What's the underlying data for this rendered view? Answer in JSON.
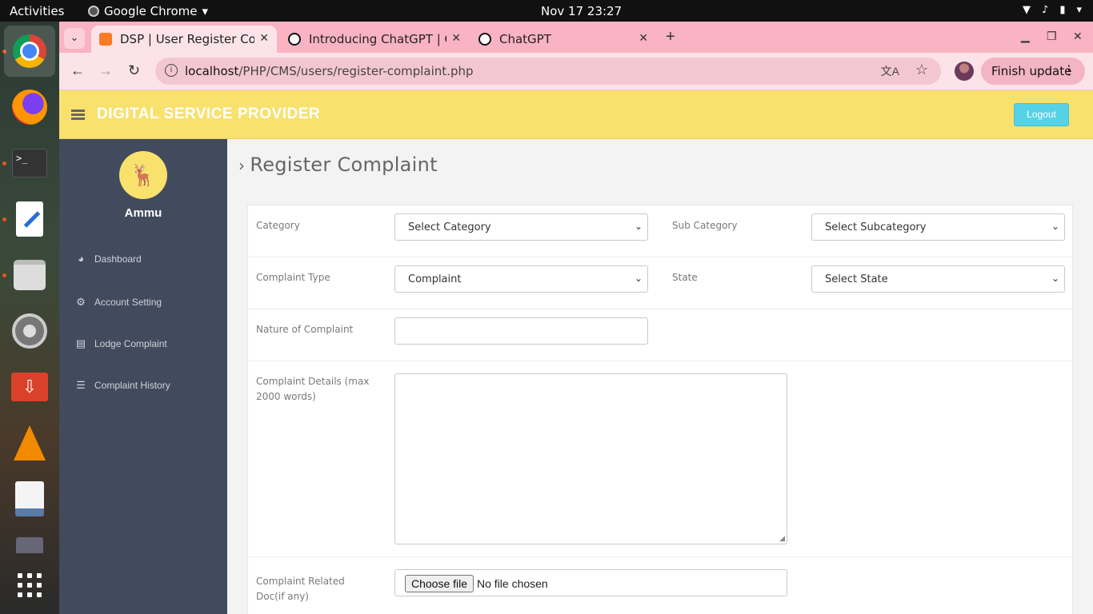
{
  "os": {
    "activities": "Activities",
    "app_name": "Google Chrome",
    "clock": "Nov 17  23:27"
  },
  "dock": {
    "terminal_glyph": ">_",
    "download_glyph": "⇩",
    "icons": [
      "chrome-icon",
      "firefox-icon",
      "terminal-icon",
      "text-editor-icon",
      "files-icon",
      "settings-icon",
      "downloader-icon",
      "vlc-icon",
      "reader-icon",
      "disk-icon",
      "app-grid-icon"
    ]
  },
  "browser": {
    "tabs": [
      {
        "title": "DSP | User Register Com",
        "active": true
      },
      {
        "title": "Introducing ChatGPT | O",
        "active": false
      },
      {
        "title": "ChatGPT",
        "active": false
      }
    ],
    "url_host": "localhost",
    "url_path": "/PHP/CMS/users/register-complaint.php",
    "finish_update": "Finish update"
  },
  "site": {
    "brand": "DIGITAL SERVICE PROVIDER",
    "logout": "Logout",
    "header_color": "#f9e16e",
    "sidebar_color": "#424a5d",
    "logout_color": "#56d2e6"
  },
  "sidebar": {
    "user_name": "Ammu",
    "items": [
      {
        "label": "Dashboard",
        "icon": "dashboard-icon"
      },
      {
        "label": "Account Setting",
        "icon": "gears-icon"
      },
      {
        "label": "Lodge Complaint",
        "icon": "book-icon"
      },
      {
        "label": "Complaint History",
        "icon": "list-icon"
      }
    ]
  },
  "page": {
    "title": "Register Complaint"
  },
  "form": {
    "category_label": "Category",
    "category_value": "Select Category",
    "subcategory_label": "Sub Category",
    "subcategory_value": "Select Subcategory",
    "type_label": "Complaint Type",
    "type_value": "Complaint",
    "state_label": "State",
    "state_value": "Select State",
    "nature_label": "Nature of Complaint",
    "nature_value": "",
    "details_label_1": "Complaint Details (max",
    "details_label_2": "2000 words)",
    "details_value": "",
    "doc_label_1": "Complaint Related",
    "doc_label_2": "Doc(if any)",
    "choose_file": "Choose file",
    "no_file": "No file chosen"
  }
}
